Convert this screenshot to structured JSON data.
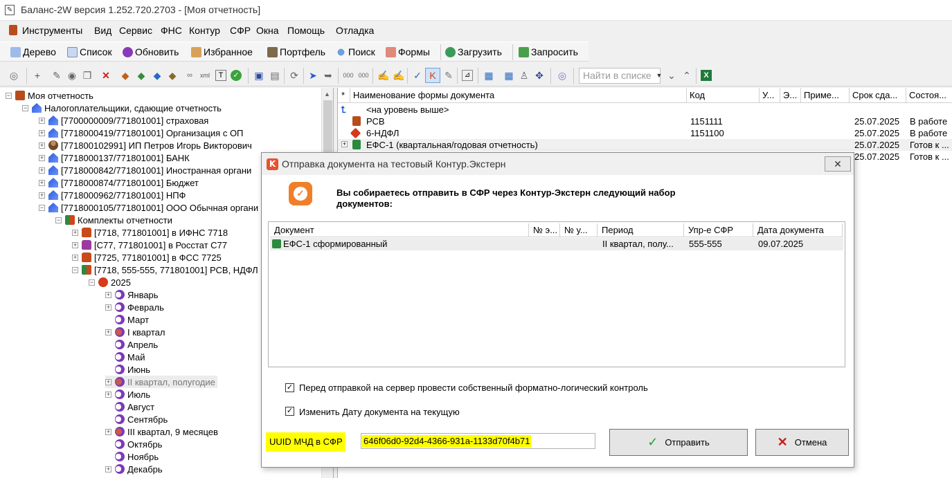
{
  "window": {
    "title": "Баланс-2W  версия 1.252.720.2703 - [Моя отчетность]",
    "app_icon": "document-icon"
  },
  "menu": [
    "Инструменты",
    "Вид",
    "Сервис",
    "ФНС",
    "Контур",
    "СФР",
    "Окна",
    "Помощь",
    "Отладка"
  ],
  "toolbar1": {
    "tree": "Дерево",
    "list": "Список",
    "refresh": "Обновить",
    "favorites": "Избранное",
    "portfolio": "Портфель",
    "search": "Поиск",
    "forms": "Формы",
    "load": "Загрузить",
    "request": "Запросить"
  },
  "toolbar2": {
    "search_placeholder": "Найти в списке"
  },
  "tree": {
    "root": "Моя отчетность",
    "taxpayers": "Налогоплательщики, сдающие отчетность",
    "orgs": [
      "[7700000009/771801001] страховая",
      "[7718000419/771801001] Организация с ОП",
      "[771800102991] ИП Петров Игорь Викторович",
      "[7718000137/771801001] БАНК",
      "[7718000842/771801001] Иностранная органи",
      "[7718000874/771801001] Бюджет",
      "[7718000962/771801001] НПФ",
      "[7718000105/771801001] ООО Обычная органи"
    ],
    "kits_label": "Комплекты отчетности",
    "kits": [
      "[7718, 771801001] в ИФНС 7718",
      "[С77, 771801001] в Росстат С77",
      "[7725, 771801001] в ФСС 7725",
      "[7718, 555-555, 771801001] РСВ, НДФЛ"
    ],
    "year": "2025",
    "periods": [
      "Январь",
      "Февраль",
      "Март",
      "I квартал",
      "Апрель",
      "Май",
      "Июнь",
      "II квартал, полугодие",
      "Июль",
      "Август",
      "Сентябрь",
      "III квартал, 9 месяцев",
      "Октябрь",
      "Ноябрь",
      "Декабрь"
    ]
  },
  "list": {
    "columns": {
      "star": "*",
      "name": "Наименование формы документа",
      "code": "Код",
      "u": "У...",
      "e": "Э...",
      "note": "Приме...",
      "due": "Срок сда...",
      "state": "Состоя..."
    },
    "up_level": "<на уровень выше>",
    "rows": [
      {
        "name": "РСВ",
        "code": "1151111",
        "due": "25.07.2025",
        "state": "В работе"
      },
      {
        "name": "6-НДФЛ",
        "code": "1151100",
        "due": "25.07.2025",
        "state": "В работе"
      },
      {
        "name": "ЕФС-1 (квартальная/годовая отчетность)",
        "code": "",
        "due": "25.07.2025",
        "state": "Готов к ..."
      },
      {
        "name": "",
        "code": "",
        "due": "25.07.2025",
        "state": "Готов к ..."
      }
    ]
  },
  "dialog": {
    "title": "Отправка документа на тестовый Контур.Экстерн",
    "close": "✕",
    "message_line1": "Вы собираетесь отправить в СФР через Контур-Экстерн следующий набор",
    "message_line2": "документов:",
    "grid_headers": {
      "doc": "Документ",
      "ne": "№ э...",
      "nu": "№ у...",
      "period": "Период",
      "upr": "Упр-е СФР",
      "date": "Дата документа"
    },
    "grid_row": {
      "doc": "ЕФС-1 сформированный",
      "period": "II квартал, полу...",
      "upr": "555-555",
      "date": "09.07.2025"
    },
    "check1": "Перед отправкой на сервер провести собственный форматно-логический контроль",
    "check2": "Изменить Дату документа на текущую",
    "uuid_label": "UUID МЧД в СФР",
    "uuid_value": "646f06d0-92d4-4366-931a-1133d70f4b71",
    "send": "Отправить",
    "cancel": "Отмена"
  }
}
